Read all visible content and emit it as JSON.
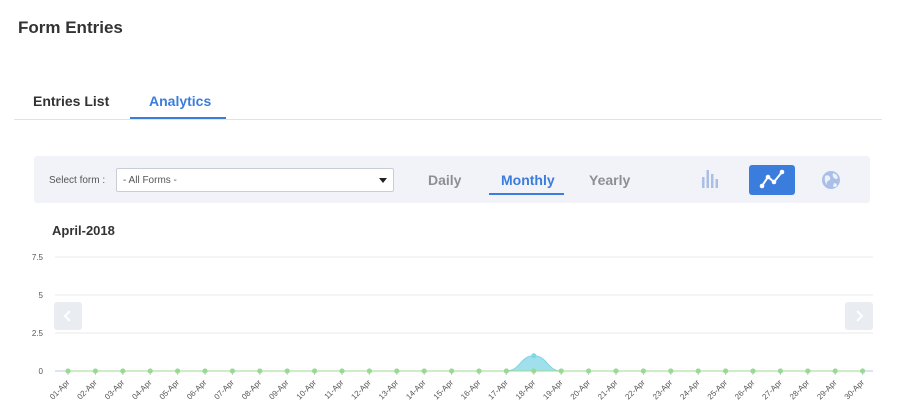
{
  "page": {
    "title": "Form Entries"
  },
  "tabs": [
    {
      "label": "Entries List",
      "active": false
    },
    {
      "label": "Analytics",
      "active": true
    }
  ],
  "toolbar": {
    "select_label": "Select form :",
    "select_value": "- All Forms -",
    "periods": [
      {
        "label": "Daily",
        "active": false
      },
      {
        "label": "Monthly",
        "active": true
      },
      {
        "label": "Yearly",
        "active": false
      }
    ],
    "chart_types": [
      {
        "icon": "bar-chart-icon",
        "active": false
      },
      {
        "icon": "line-chart-icon",
        "active": true
      },
      {
        "icon": "globe-icon",
        "active": false
      }
    ],
    "accent_color": "#3b7ddd"
  },
  "chart_title": "April-2018",
  "chart_data": {
    "type": "area",
    "title": "April-2018",
    "xlabel": "",
    "ylabel": "",
    "ylim": [
      0,
      7.5
    ],
    "yticks": [
      "0",
      "2.5",
      "5",
      "7.5"
    ],
    "categories": [
      "01-Apr",
      "02-Apr",
      "03-Apr",
      "04-Apr",
      "05-Apr",
      "06-Apr",
      "07-Apr",
      "08-Apr",
      "09-Apr",
      "10-Apr",
      "11-Apr",
      "12-Apr",
      "13-Apr",
      "14-Apr",
      "15-Apr",
      "16-Apr",
      "17-Apr",
      "18-Apr",
      "19-Apr",
      "20-Apr",
      "21-Apr",
      "22-Apr",
      "23-Apr",
      "24-Apr",
      "25-Apr",
      "26-Apr",
      "27-Apr",
      "28-Apr",
      "29-Apr",
      "30-Apr"
    ],
    "series": [
      {
        "values": [
          0,
          0,
          0,
          0,
          0,
          0,
          0,
          0,
          0,
          0,
          0,
          0,
          0,
          0,
          0,
          0,
          0,
          1,
          0,
          0,
          0,
          0,
          0,
          0,
          0,
          0,
          0,
          0,
          0,
          0
        ],
        "color": "#7fd6e6"
      },
      {
        "values": [
          0,
          0,
          0,
          0,
          0,
          0,
          0,
          0,
          0,
          0,
          0,
          0,
          0,
          0,
          0,
          0,
          0,
          0,
          0,
          0,
          0,
          0,
          0,
          0,
          0,
          0,
          0,
          0,
          0,
          0
        ],
        "color": "#9bd98f"
      }
    ],
    "grid": true,
    "legend": "none"
  }
}
